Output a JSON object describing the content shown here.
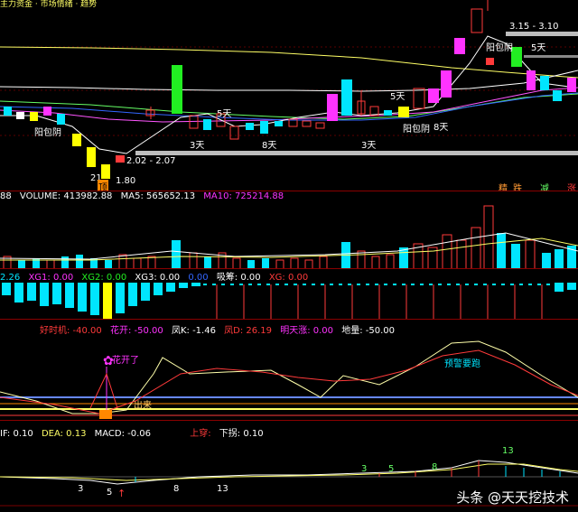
{
  "main": {
    "title": "主力资金 · 市场情绪 · 趋势",
    "labels": {
      "yangbaoyin_left": "阳包阴",
      "range_low": "2.02 - 2.07",
      "low_price": "1.80",
      "low_prefix": "21",
      "days3_a": "3天",
      "days5_a": "5天",
      "days8_a": "8天",
      "days3_b": "3天",
      "days5_b": "5天",
      "yangbaoyin_mid": "阳包阴",
      "days8_b": "8天",
      "yangbaoyin_right": "阳包阴",
      "range_high": "3.15 - 3.10",
      "days5_c": "5天"
    },
    "badges": {
      "left": "顶",
      "r1": "精",
      "r2": "跌",
      "r3": "减",
      "r4": "涨"
    }
  },
  "volume": {
    "prefix": "88",
    "volume_label": "VOLUME: 413982.88",
    "ma5_label": "MA5: 565652.13",
    "ma10_label": "MA10: 725214.88"
  },
  "indicator1": {
    "prefix": "2.26",
    "xg1": "XG1: 0.00",
    "xg2": "XG2: 0.00",
    "xg3": "XG3: 0.00",
    "extra1": "0.00",
    "xichou": "吸筹: 0.00",
    "xg_last": "XG: 0.00"
  },
  "indicator2": {
    "haoshiji": "好时机: -40.00",
    "huakai": "花开: -50.00",
    "fengk": "凤K: -1.46",
    "fengd": "凤D: 26.19",
    "mingtianzhang": "明天涨: 0.00",
    "diliang": "地量: -50.00",
    "flower_label": "花开了",
    "alert_label": "预警要跑",
    "chulai": "出来"
  },
  "macd": {
    "dif": "IF: 0.10",
    "dea": "DEA: 0.13",
    "macd": "MACD: -0.06",
    "shangchuan": "上穿:",
    "xiaguai": "下拐: 0.10",
    "n3": "3",
    "n5a": "5",
    "n8a": "8",
    "n13a": "13",
    "n3b": "3",
    "n5b": "5",
    "n8b": "8",
    "n13b": "13"
  },
  "watermark": "头条 @天天挖技术",
  "colors": {
    "up": "#ff3a3a",
    "down": "#00e5ff",
    "magenta": "#ff33ff",
    "green": "#22ee22",
    "yellow": "#ffff00",
    "gray": "#aaaaaa"
  }
}
